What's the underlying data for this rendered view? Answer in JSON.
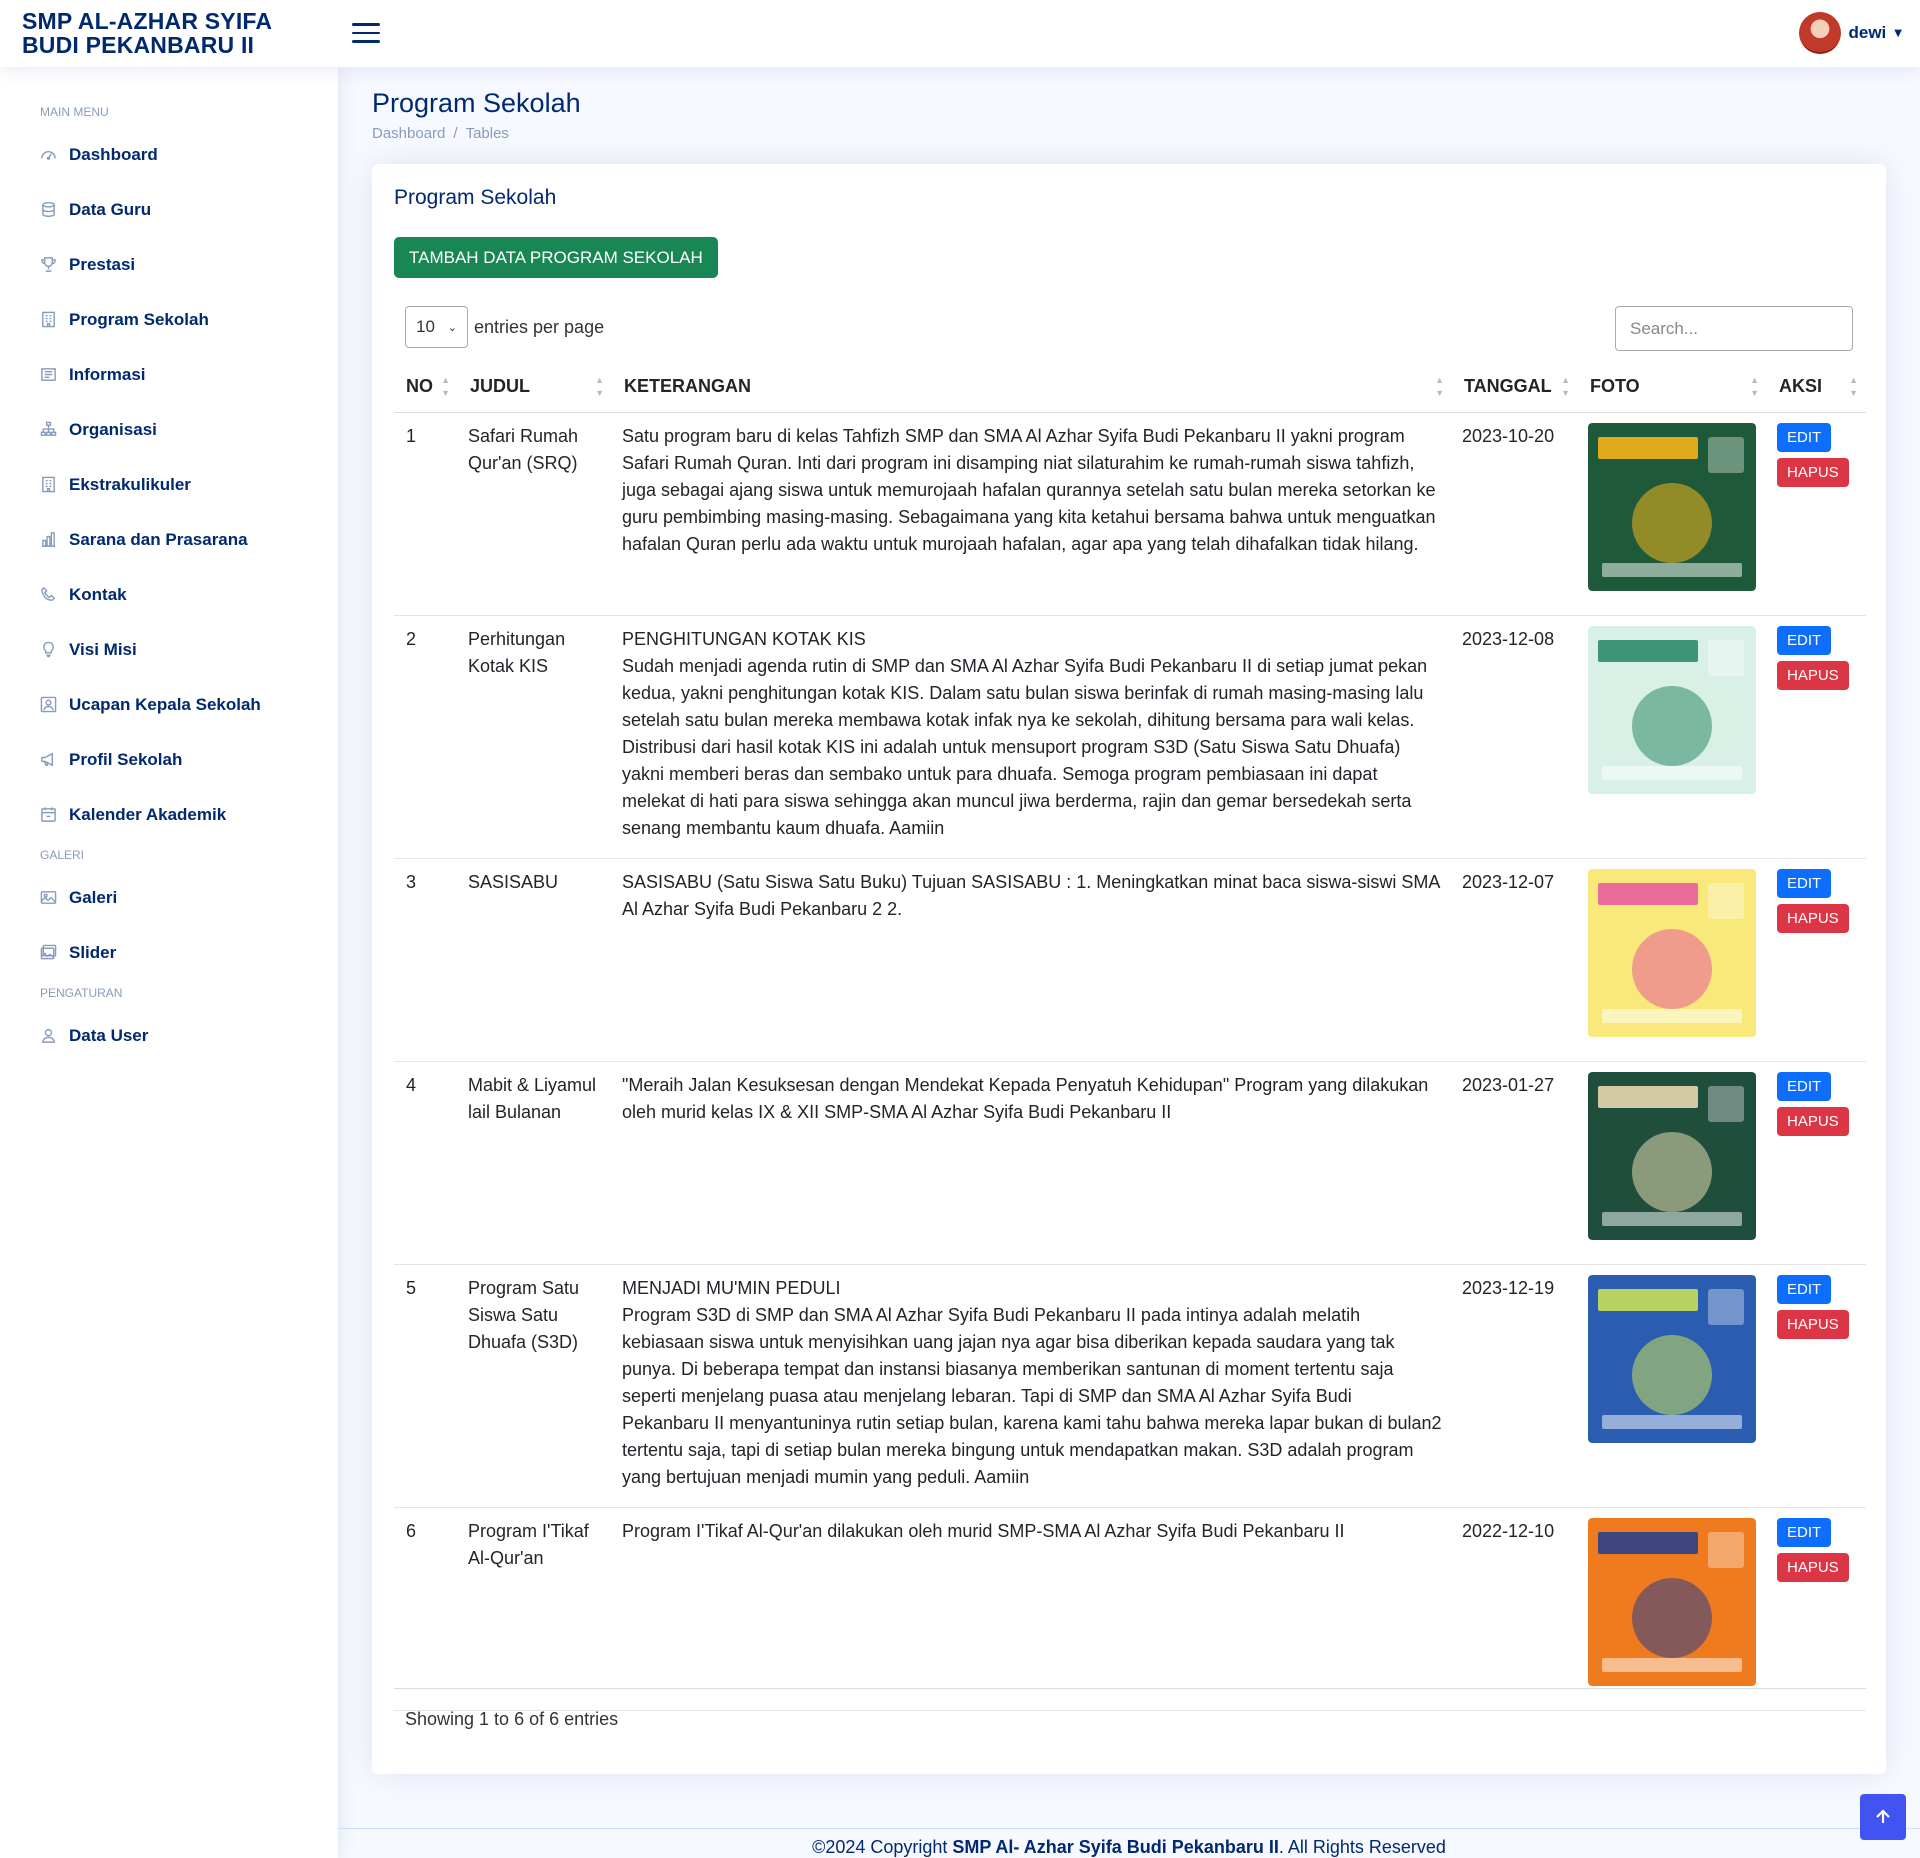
{
  "header": {
    "logo_line1": "SMP AL-AZHAR SYIFA",
    "logo_line2": "BUDI PEKANBARU II",
    "username": "dewi"
  },
  "sidebar": {
    "main_heading": "MAIN MENU",
    "items": [
      {
        "label": "Dashboard",
        "icon": "speedometer-icon"
      },
      {
        "label": "Data Guru",
        "icon": "database-icon"
      },
      {
        "label": "Prestasi",
        "icon": "trophy-icon"
      },
      {
        "label": "Program Sekolah",
        "icon": "building-icon"
      },
      {
        "label": "Informasi",
        "icon": "newspaper-icon"
      },
      {
        "label": "Organisasi",
        "icon": "diagram-icon"
      },
      {
        "label": "Ekstrakulikuler",
        "icon": "building-icon"
      },
      {
        "label": "Sarana dan Prasarana",
        "icon": "bar-chart-icon"
      },
      {
        "label": "Kontak",
        "icon": "telephone-icon"
      },
      {
        "label": "Visi Misi",
        "icon": "lightbulb-icon"
      },
      {
        "label": "Ucapan Kepala Sekolah",
        "icon": "person-square-icon"
      },
      {
        "label": "Profil Sekolah",
        "icon": "megaphone-icon"
      },
      {
        "label": "Kalender Akademik",
        "icon": "calendar-icon"
      }
    ],
    "galeri_heading": "GALERI",
    "galeri_items": [
      {
        "label": "Galeri",
        "icon": "image-icon"
      },
      {
        "label": "Slider",
        "icon": "images-icon"
      }
    ],
    "pengaturan_heading": "PENGATURAN",
    "pengaturan_items": [
      {
        "label": "Data User",
        "icon": "person-icon"
      }
    ]
  },
  "page": {
    "title": "Program Sekolah",
    "breadcrumb": [
      "Dashboard",
      "Tables"
    ]
  },
  "card": {
    "title": "Program Sekolah",
    "add_button": "TAMBAH DATA PROGRAM SEKOLAH",
    "entries_value": "10",
    "entries_label": "entries per page",
    "search_placeholder": "Search...",
    "columns": [
      "NO",
      "JUDUL",
      "KETERANGAN",
      "TANGGAL",
      "FOTO",
      "AKSI"
    ],
    "rows": [
      {
        "no": "1",
        "judul": "Safari Rumah Qur'an (SRQ)",
        "ket_title": "",
        "ket": "Satu program baru di kelas Tahfizh SMP dan SMA Al Azhar Syifa Budi Pekanbaru II yakni program Safari Rumah Quran. Inti dari program ini disamping niat silaturahim ke rumah-rumah siswa tahfizh, juga sebagai ajang siswa untuk memurojaah hafalan qurannya setelah satu bulan mereka setorkan ke guru pembimbing masing-masing. Sebagaimana yang kita ketahui bersama bahwa untuk menguatkan hafalan Quran perlu ada waktu untuk murojaah hafalan, agar apa yang telah dihafalkan tidak hilang.",
        "tanggal": "2023-10-20",
        "foto_colors": [
          "#1e5a3a",
          "#f4b41a"
        ]
      },
      {
        "no": "2",
        "judul": "Perhitungan Kotak KIS",
        "ket_title": "PENGHITUNGAN KOTAK KIS",
        "ket": "Sudah menjadi agenda rutin di SMP dan SMA Al Azhar Syifa Budi Pekanbaru II di setiap jumat pekan kedua, yakni penghitungan kotak KIS. Dalam satu bulan siswa berinfak di rumah masing-masing lalu setelah satu bulan mereka membawa kotak infak nya ke sekolah, dihitung bersama para wali kelas. Distribusi dari hasil kotak KIS ini adalah untuk mensuport program S3D (Satu Siswa Satu Dhuafa) yakni memberi beras dan sembako untuk para dhuafa. Semoga program pembiasaan ini dapat melekat di hati para siswa sehingga akan muncul jiwa berderma, rajin dan gemar bersedekah serta senang membantu kaum dhuafa. Aamiin",
        "tanggal": "2023-12-08",
        "foto_colors": [
          "#d8f0e6",
          "#2e8b6a"
        ]
      },
      {
        "no": "3",
        "judul": "SASISABU",
        "ket_title": "",
        "ket": "SASISABU (Satu Siswa Satu Buku) Tujuan SASISABU : 1. Meningkatkan minat baca siswa-siswi SMA Al Azhar Syifa Budi Pekanbaru 2 2.",
        "tanggal": "2023-12-07",
        "foto_colors": [
          "#f9e87a",
          "#e85d9a"
        ]
      },
      {
        "no": "4",
        "judul": "Mabit & Liyamul lail Bulanan",
        "ket_title": "",
        "ket": "\"Meraih Jalan Kesuksesan dengan Mendekat Kepada Penyatuh Kehidupan\" Program yang dilakukan oleh murid kelas IX & XII SMP-SMA Al Azhar Syifa Budi Pekanbaru II",
        "tanggal": "2023-01-27",
        "foto_colors": [
          "#1f4e3d",
          "#e6d8b0"
        ]
      },
      {
        "no": "5",
        "judul": "Program Satu Siswa Satu Dhuafa (S3D)",
        "ket_title": "MENJADI MU'MIN PEDULI",
        "ket": "Program S3D di SMP dan SMA Al Azhar Syifa Budi Pekanbaru II pada intinya adalah melatih kebiasaan siswa untuk menyisihkan uang jajan nya agar bisa diberikan kepada saudara yang tak punya. Di beberapa tempat dan instansi biasanya memberikan santunan di moment tertentu saja seperti menjelang puasa atau menjelang lebaran. Tapi di SMP dan SMA Al Azhar Syifa Budi Pekanbaru II menyantuninya rutin setiap bulan, karena kami tahu bahwa mereka lapar bukan di bulan2 tertentu saja, tapi di setiap bulan mereka bingung untuk mendapatkan makan. S3D adalah program yang bertujuan menjadi mumin yang peduli. Aamiin",
        "tanggal": "2023-12-19",
        "foto_colors": [
          "#2a5db0",
          "#c8e05a"
        ]
      },
      {
        "no": "6",
        "judul": "Program I'Tikaf Al-Qur'an",
        "ket_title": "",
        "ket": "Program I'Tikaf Al-Qur'an dilakukan oleh murid SMP-SMA Al Azhar Syifa Budi Pekanbaru II",
        "tanggal": "2022-12-10",
        "foto_colors": [
          "#f07a1e",
          "#2a3f8a"
        ]
      }
    ],
    "edit_label": "EDIT",
    "delete_label": "HAPUS",
    "info": "Showing 1 to 6 of 6 entries"
  },
  "footer": {
    "prefix": "©2024 Copyright ",
    "brand": "SMP Al- Azhar Syifa Budi Pekanbaru II",
    "suffix": ". All Rights Reserved"
  },
  "colors": {
    "primary_navy": "#012970",
    "success": "#198754",
    "edit": "#0d6efd",
    "delete": "#dc3545",
    "backtop": "#4154f1"
  }
}
